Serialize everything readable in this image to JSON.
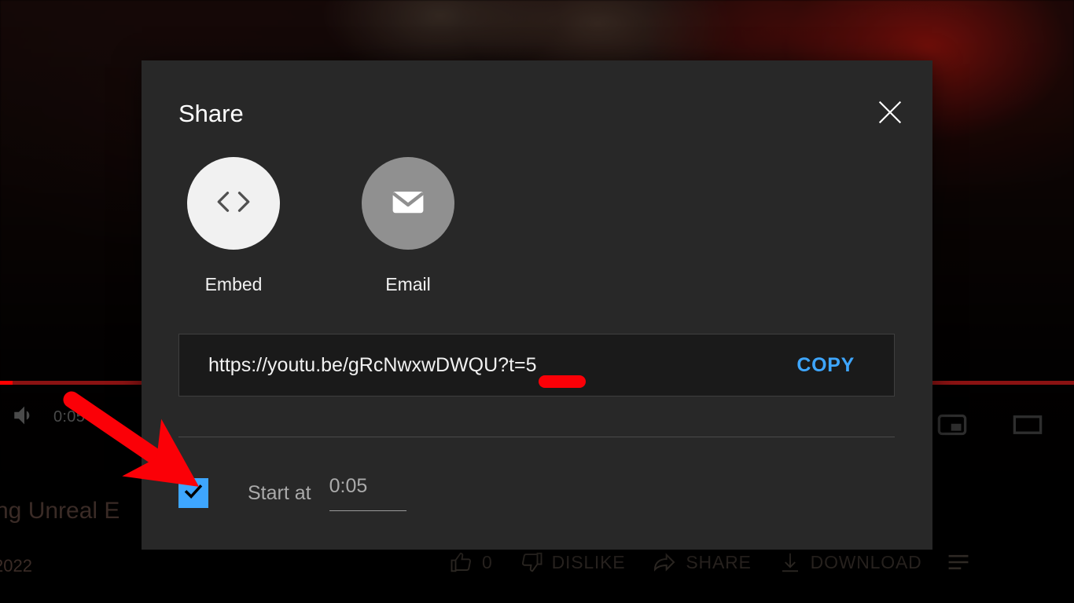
{
  "player": {
    "volume_icon": "volume-icon",
    "time_display": "0:05 /",
    "progress_percent": 1.2,
    "miniplayer_icon": "miniplayer-icon",
    "theater_icon": "theater-mode-icon"
  },
  "video": {
    "title_fragment": "ng Unreal E",
    "date_fragment": "2022"
  },
  "actions": [
    {
      "name": "like",
      "icon": "thumbs-up-icon",
      "label": "0"
    },
    {
      "name": "dislike",
      "icon": "thumbs-down-icon",
      "label": "DISLIKE"
    },
    {
      "name": "share",
      "icon": "share-arrow-icon",
      "label": "SHARE"
    },
    {
      "name": "download",
      "icon": "download-icon",
      "label": "DOWNLOAD"
    },
    {
      "name": "save",
      "icon": "save-to-playlist-icon",
      "label": ""
    }
  ],
  "dialog": {
    "title": "Share",
    "close_icon": "close-icon",
    "targets": [
      {
        "name": "embed",
        "icon": "code-brackets-icon",
        "label": "Embed"
      },
      {
        "name": "email",
        "icon": "envelope-icon",
        "label": "Email"
      }
    ],
    "url_value": "https://youtu.be/gRcNwxwDWQU?t=5",
    "copy_label": "COPY",
    "start_at": {
      "checked": true,
      "label": "Start at",
      "time_value": "0:05"
    }
  },
  "colors": {
    "dialog_bg": "#282828",
    "accent_blue": "#3ea6ff",
    "annotation_red": "#fb0007",
    "embed_circle": "#f1f1f1",
    "email_circle": "#909090",
    "progress_red": "#ff0000"
  }
}
